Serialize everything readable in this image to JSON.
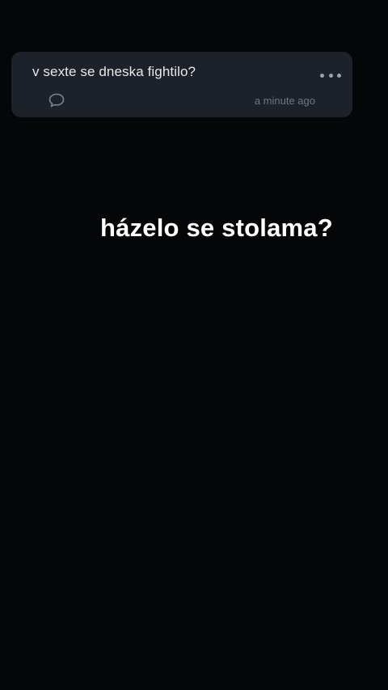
{
  "question_card": {
    "question": "v sexte se dneska fightilo?",
    "timestamp": "a minute ago",
    "more_icon": "more-horizontal-icon",
    "comment_icon": "comment-bubble-icon"
  },
  "story": {
    "caption": "házelo se stolama?"
  },
  "colors": {
    "background": "#050607",
    "card": "#1d222a",
    "card_text": "#e6e8eb",
    "muted": "#6f7680",
    "caption": "#ffffff"
  }
}
